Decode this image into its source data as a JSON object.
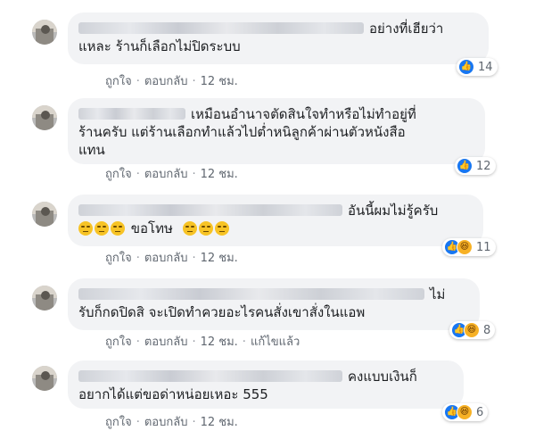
{
  "meta_labels": {
    "like": "ถูกใจ",
    "reply": "ตอบกลับ",
    "time": "12 ชม.",
    "edited": "แก้ไขแล้ว"
  },
  "comments": [
    {
      "line1": "อย่างที่เฮียว่า",
      "line2": "แหละ ร้านก็เลือกไม่ปิดระบบ",
      "reaction_count": "14",
      "reactions": [
        "like"
      ]
    },
    {
      "line1": "เหมือนอำนาจตัดสินใจทำหรือไม่ทำอยู่ที่",
      "line2": "ร้านครับ แต่ร้านเลือกทำแล้วไปต่ำหนิลูกค้าผ่านตัวหนังสือ",
      "line3": "แทน",
      "reaction_count": "12",
      "reactions": [
        "like"
      ]
    },
    {
      "line1": "อันนี้ผมไม่รู้ครับ",
      "line2": "ขอโทษ",
      "reaction_count": "11",
      "reactions": [
        "like",
        "haha"
      ]
    },
    {
      "line1": "ไม่",
      "line2": "รับก็กดปิดสิ จะเปิดทำควยอะไรคนสั่งเขาสั่งในแอพ",
      "reaction_count": "8",
      "reactions": [
        "like",
        "haha"
      ],
      "edited": true
    },
    {
      "line1": "คงแบบเงินก็",
      "line2": "อยากได้แต่ขอด่าหน่อยเหอะ 555",
      "reaction_count": "6",
      "reactions": [
        "like",
        "haha"
      ]
    }
  ],
  "icons": {
    "like": "thumbs-up-icon",
    "haha": "laughing-face-icon",
    "emoji": "expressionless-face-icon"
  },
  "colors": {
    "like": "#1877f2",
    "haha": "#f7b125",
    "bubble": "#f2f3f5"
  }
}
